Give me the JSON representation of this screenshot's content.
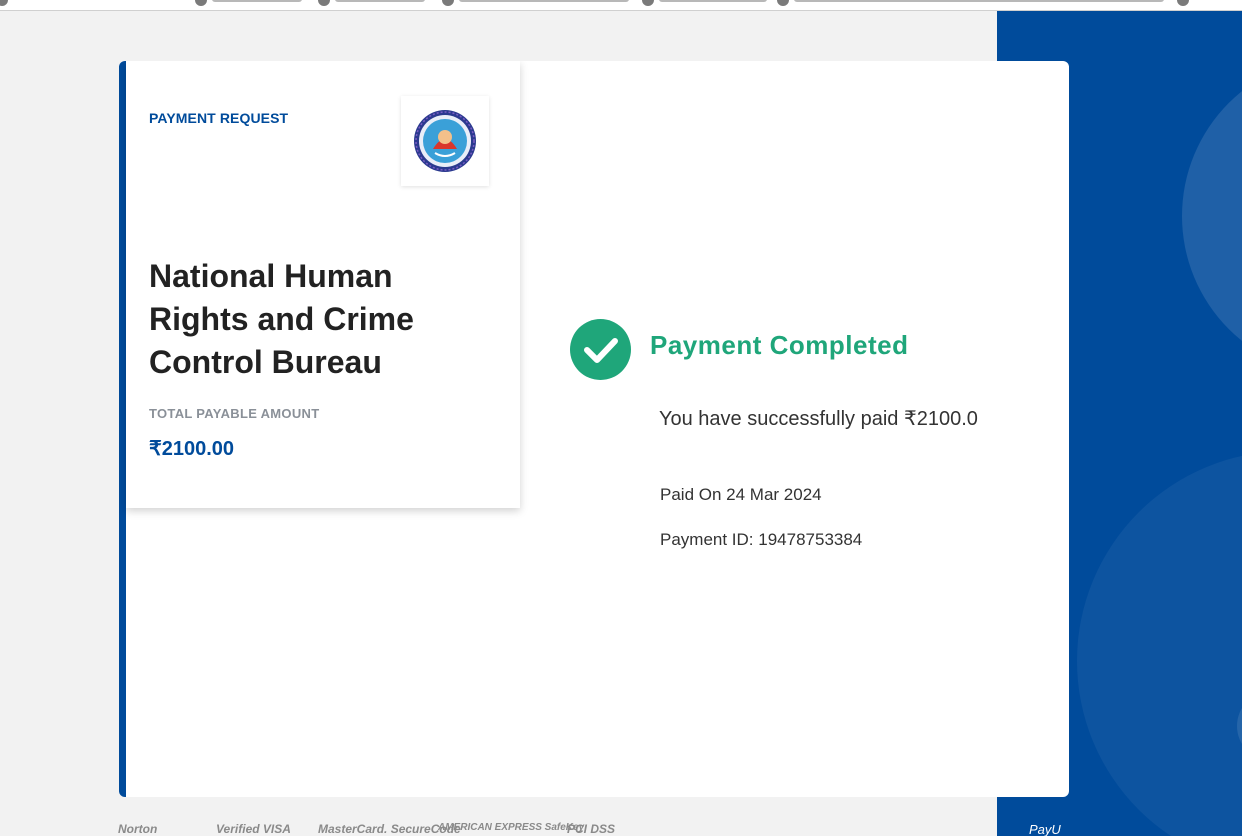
{
  "payment_card": {
    "request_label": "PAYMENT REQUEST",
    "organization_name": "National Human Rights and Crime Control Bureau",
    "amount_label": "TOTAL PAYABLE AMOUNT",
    "amount_value": "₹2100.00"
  },
  "status": {
    "title": "Payment Completed",
    "message": "You have successfully paid ₹2100.0",
    "paid_on": "Paid On 24 Mar 2024",
    "payment_id": "Payment ID: 19478753384"
  },
  "security_badges": [
    "Norton",
    "Verified VISA",
    "MasterCard. SecureCode",
    "AMERICAN EXPRESS SafeKey",
    "PCI DSS"
  ],
  "brand": {
    "payu_logo": "PayU"
  },
  "colors": {
    "brand_blue": "#004b9b",
    "success_green": "#1fa67a",
    "text_dark": "#222222",
    "muted_gray": "#8a9098"
  },
  "icons": {
    "status": "check-icon",
    "logo": "organization-logo"
  }
}
